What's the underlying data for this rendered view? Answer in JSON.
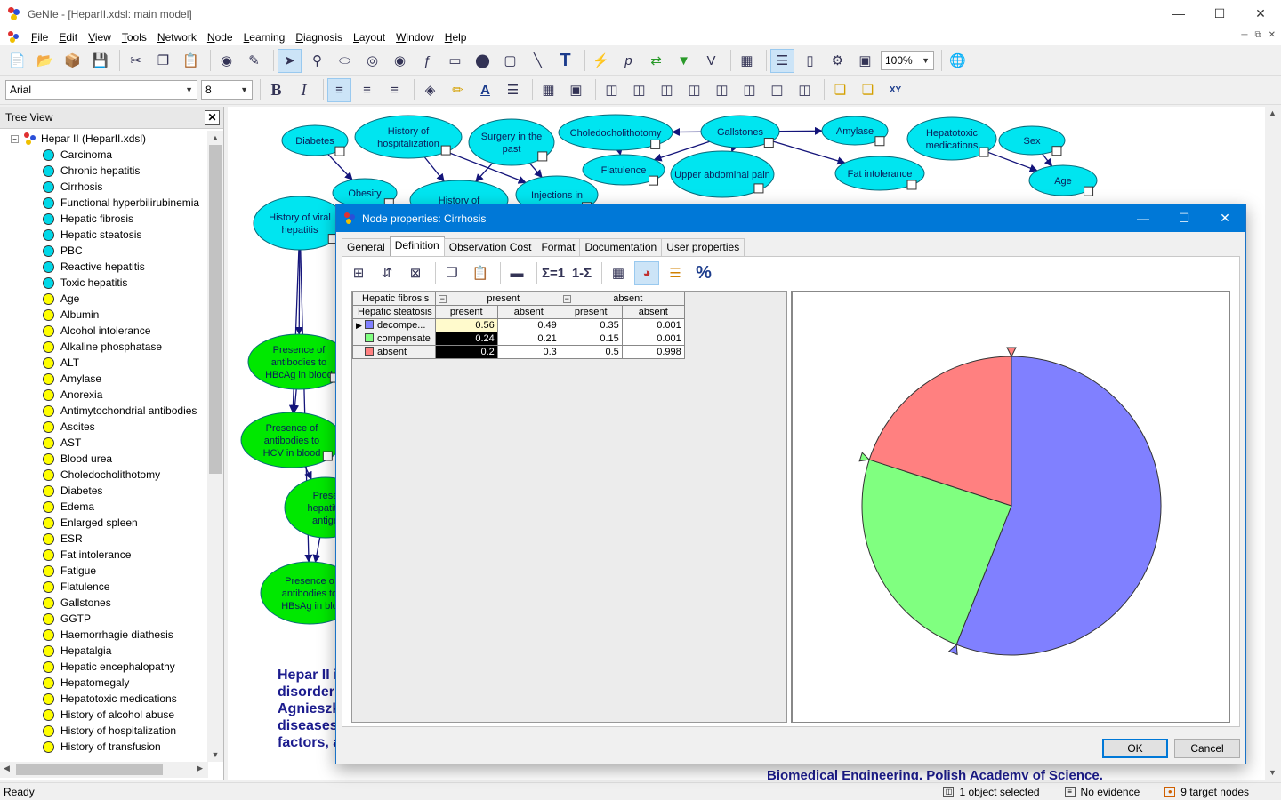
{
  "window": {
    "title": "GeNIe - [HeparII.xdsl: main model]"
  },
  "menu": [
    "File",
    "Edit",
    "View",
    "Tools",
    "Network",
    "Node",
    "Learning",
    "Diagnosis",
    "Layout",
    "Window",
    "Help"
  ],
  "toolbar": {
    "zoom": "100%",
    "font": "Arial",
    "font_size": "8"
  },
  "tree": {
    "header": "Tree View",
    "root": "Hepar II (HeparII.xdsl)",
    "items": [
      {
        "label": "Carcinoma",
        "color": "#00d8e8"
      },
      {
        "label": "Chronic hepatitis",
        "color": "#00d8e8"
      },
      {
        "label": "Cirrhosis",
        "color": "#00d8e8"
      },
      {
        "label": "Functional hyperbilirubinemia",
        "color": "#00d8e8"
      },
      {
        "label": "Hepatic fibrosis",
        "color": "#00d8e8"
      },
      {
        "label": "Hepatic steatosis",
        "color": "#00d8e8"
      },
      {
        "label": "PBC",
        "color": "#00d8e8"
      },
      {
        "label": "Reactive hepatitis",
        "color": "#00d8e8"
      },
      {
        "label": "Toxic hepatitis",
        "color": "#00d8e8"
      },
      {
        "label": "Age",
        "color": "#ffff00"
      },
      {
        "label": "Albumin",
        "color": "#ffff00"
      },
      {
        "label": "Alcohol intolerance",
        "color": "#ffff00"
      },
      {
        "label": "Alkaline phosphatase",
        "color": "#ffff00"
      },
      {
        "label": "ALT",
        "color": "#ffff00"
      },
      {
        "label": "Amylase",
        "color": "#ffff00"
      },
      {
        "label": "Anorexia",
        "color": "#ffff00"
      },
      {
        "label": "Antimytochondrial antibodies",
        "color": "#ffff00"
      },
      {
        "label": "Ascites",
        "color": "#ffff00"
      },
      {
        "label": "AST",
        "color": "#ffff00"
      },
      {
        "label": "Blood urea",
        "color": "#ffff00"
      },
      {
        "label": "Choledocholithotomy",
        "color": "#ffff00"
      },
      {
        "label": "Diabetes",
        "color": "#ffff00"
      },
      {
        "label": "Edema",
        "color": "#ffff00"
      },
      {
        "label": "Enlarged spleen",
        "color": "#ffff00"
      },
      {
        "label": "ESR",
        "color": "#ffff00"
      },
      {
        "label": "Fat intolerance",
        "color": "#ffff00"
      },
      {
        "label": "Fatigue",
        "color": "#ffff00"
      },
      {
        "label": "Flatulence",
        "color": "#ffff00"
      },
      {
        "label": "Gallstones",
        "color": "#ffff00"
      },
      {
        "label": "GGTP",
        "color": "#ffff00"
      },
      {
        "label": "Haemorrhagie diathesis",
        "color": "#ffff00"
      },
      {
        "label": "Hepatalgia",
        "color": "#ffff00"
      },
      {
        "label": "Hepatic encephalopathy",
        "color": "#ffff00"
      },
      {
        "label": "Hepatomegaly",
        "color": "#ffff00"
      },
      {
        "label": "Hepatotoxic medications",
        "color": "#ffff00"
      },
      {
        "label": "History of alcohol abuse",
        "color": "#ffff00"
      },
      {
        "label": "History of hospitalization",
        "color": "#ffff00"
      },
      {
        "label": "History of transfusion",
        "color": "#ffff00"
      }
    ]
  },
  "network": {
    "nodes": [
      {
        "label": "Diabetes",
        "color": "#00e5f0"
      },
      {
        "label": "History of hospitalization",
        "color": "#00e5f0"
      },
      {
        "label": "Surgery in the past",
        "color": "#00e5f0"
      },
      {
        "label": "Choledocholithotomy",
        "color": "#00e5f0"
      },
      {
        "label": "Gallstones",
        "color": "#00e5f0"
      },
      {
        "label": "Amylase",
        "color": "#00e5f0"
      },
      {
        "label": "Hepatotoxic medications",
        "color": "#00e5f0"
      },
      {
        "label": "Sex",
        "color": "#00e5f0"
      },
      {
        "label": "Age",
        "color": "#00e5f0"
      },
      {
        "label": "Flatulence",
        "color": "#00e5f0"
      },
      {
        "label": "Upper abdominal pain",
        "color": "#00e5f0"
      },
      {
        "label": "Fat intolerance",
        "color": "#00e5f0"
      },
      {
        "label": "Obesity",
        "color": "#00e5f0"
      },
      {
        "label": "History of",
        "color": "#00e5f0"
      },
      {
        "label": "Injections in",
        "color": "#00e5f0"
      },
      {
        "label": "History of viral hepatitis",
        "color": "#00e5f0"
      },
      {
        "label": "Presence of antibodies to HBcAg in blood",
        "color": "#00e800"
      },
      {
        "label": "Presence of antibodies to HCV in blood",
        "color": "#00e800"
      },
      {
        "label": "Prese hepatitis antige",
        "color": "#00e800"
      },
      {
        "label": "Presence o antibodies to HBsAg in blo",
        "color": "#00e800"
      }
    ],
    "description_lines": [
      "Hepar II i",
      "disorder",
      "Agnieszk",
      "diseases",
      "factors, a"
    ],
    "footer_text": "Biomedical Engineering, Polish Academy of Science."
  },
  "status": {
    "ready": "Ready",
    "selection": "1 object selected",
    "evidence": "No evidence",
    "targets": "9 target nodes"
  },
  "dialog": {
    "title": "Node properties: Cirrhosis",
    "tabs": [
      "General",
      "Definition",
      "Observation Cost",
      "Format",
      "Documentation",
      "User properties"
    ],
    "active_tab": "Definition",
    "ok_label": "OK",
    "cancel_label": "Cancel",
    "cpt": {
      "parent1": {
        "name": "Hepatic fibrosis",
        "states": [
          "present",
          "absent"
        ]
      },
      "parent2": {
        "name": "Hepatic steatosis",
        "states": [
          "present",
          "absent",
          "present",
          "absent"
        ]
      },
      "rows": [
        {
          "state": "decompe...",
          "color": "#8080ff",
          "values": [
            "0.56",
            "0.49",
            "0.35",
            "0.001"
          ]
        },
        {
          "state": "compensate",
          "color": "#80ff80",
          "values": [
            "0.24",
            "0.21",
            "0.15",
            "0.001"
          ]
        },
        {
          "state": "absent",
          "color": "#ff8080",
          "values": [
            "0.2",
            "0.3",
            "0.5",
            "0.998"
          ]
        }
      ]
    }
  },
  "chart_data": {
    "type": "pie",
    "labels": [
      "decompe...",
      "compensate",
      "absent"
    ],
    "values": [
      0.56,
      0.24,
      0.2
    ],
    "colors": [
      "#8080ff",
      "#80ff80",
      "#ff8080"
    ]
  }
}
